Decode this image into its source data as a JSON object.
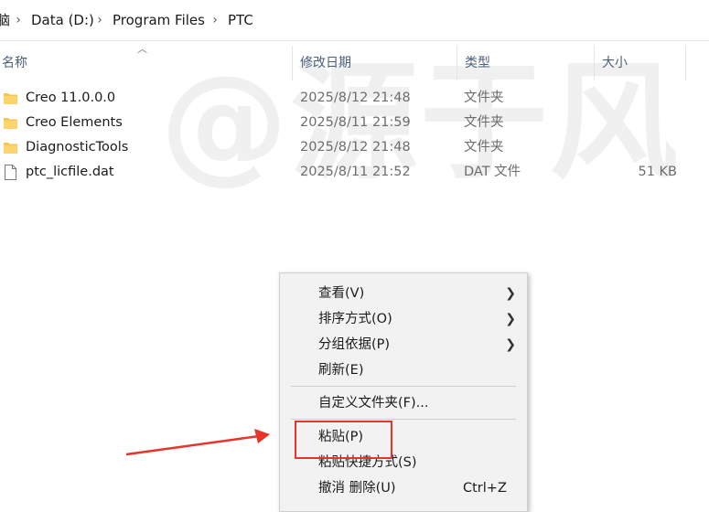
{
  "breadcrumb": {
    "partial_root": "脑",
    "items": [
      "Data (D:)",
      "Program Files",
      "PTC"
    ]
  },
  "watermark": "@源于风",
  "columns": {
    "name": "名称",
    "modified": "修改日期",
    "type": "类型",
    "size": "大小"
  },
  "files": [
    {
      "name": "Creo 11.0.0.0",
      "modified": "2025/8/12 21:48",
      "type": "文件夹",
      "size": "",
      "icon": "folder-icon"
    },
    {
      "name": "Creo Elements",
      "modified": "2025/8/11 21:59",
      "type": "文件夹",
      "size": "",
      "icon": "folder-icon"
    },
    {
      "name": "DiagnosticTools",
      "modified": "2025/8/12 21:48",
      "type": "文件夹",
      "size": "",
      "icon": "folder-icon"
    },
    {
      "name": "ptc_licfile.dat",
      "modified": "2025/8/11 21:52",
      "type": "DAT 文件",
      "size": "51 KB",
      "icon": "file-icon"
    }
  ],
  "context_menu": {
    "view": "查看(V)",
    "sort": "排序方式(O)",
    "group": "分组依据(P)",
    "refresh": "刷新(E)",
    "customize": "自定义文件夹(F)...",
    "paste": "粘贴(P)",
    "paste_shortcut": "粘贴快捷方式(S)",
    "undo_delete": "撤消 删除(U)",
    "undo_shortcut": "Ctrl+Z"
  },
  "colors": {
    "annotation_red": "#e8332a",
    "header_text": "#4c607a",
    "folder_yellow": "#f8c44a"
  }
}
